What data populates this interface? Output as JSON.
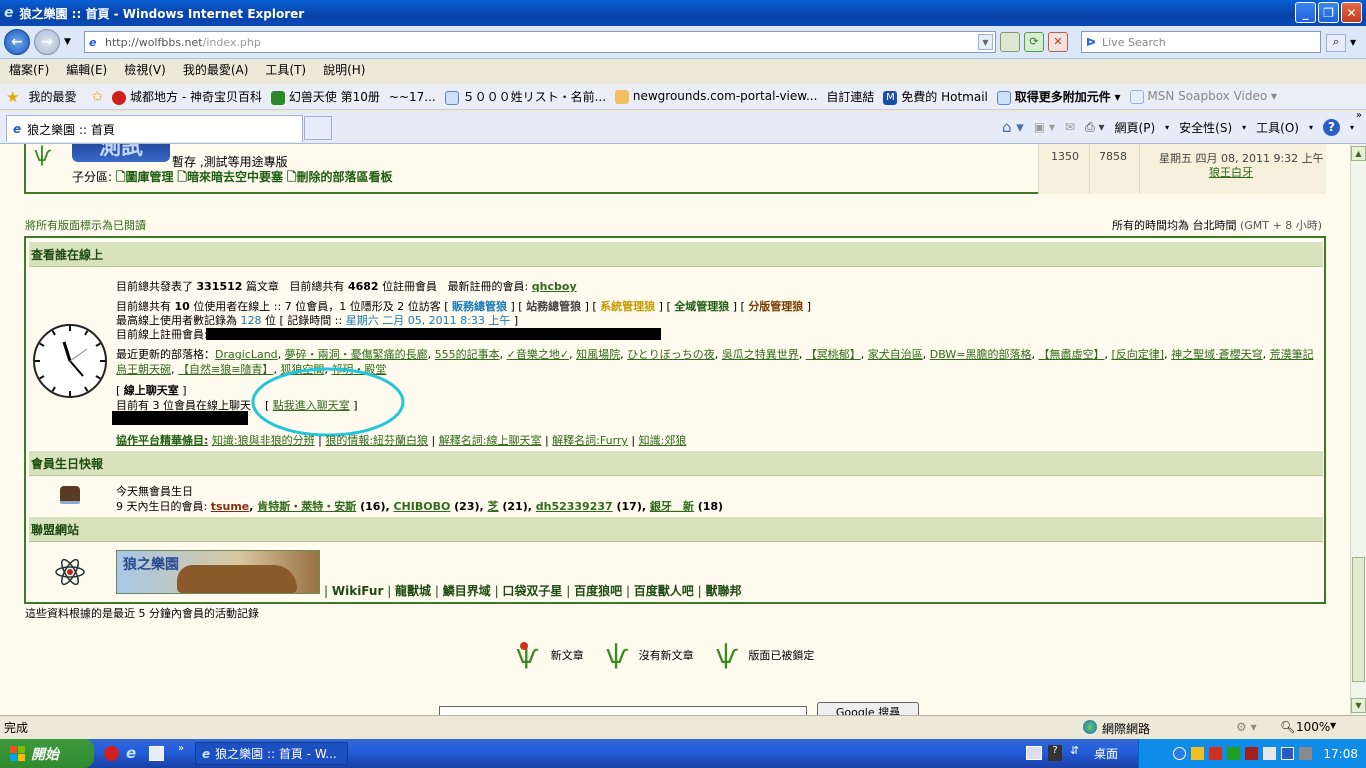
{
  "window": {
    "title": "狼之樂園 :: 首頁 - Windows Internet Explorer"
  },
  "address": {
    "url_host": "http://wolfbbs.net",
    "url_path": "/index.php"
  },
  "search": {
    "placeholder": "Live Search"
  },
  "menu": [
    "檔案(F)",
    "編輯(E)",
    "檢視(V)",
    "我的最愛(A)",
    "工具(T)",
    "說明(H)"
  ],
  "favorites": {
    "label": "我的最愛",
    "items": [
      "城都地方 - 神奇宝贝百科",
      "幻兽天使 第10册",
      "~~17...",
      "５０００姓リスト・名前...",
      "newgrounds.com-portal-view...",
      "自訂連結",
      "免費的 Hotmail",
      "取得更多附加元件",
      "MSN Soapbox Video"
    ]
  },
  "tab": {
    "label": "狼之樂園 :: 首頁"
  },
  "commandbar": [
    "網頁(P)",
    "安全性(S)",
    "工具(O)"
  ],
  "forum_top": {
    "desc": "暫存 ,測試等用途專版",
    "sub_label": "子分區:",
    "subs": [
      "圖庫管理",
      "暗來暗去空中要塞",
      "刪除的部落區看板"
    ],
    "topics": "1350",
    "posts": "7858",
    "last_time": "星期五 四月 08, 2011 9:32 上午",
    "last_user": "狼王白牙",
    "logo_text": "測試"
  },
  "mark_read": "將所有版面標示為已閱讀",
  "timezone": {
    "prefix": "所有的時間均為 台北時間",
    "suffix": "(GMT + 8 小時)"
  },
  "online": {
    "header": "查看誰在線上",
    "stats_a": "目前總共發表了",
    "stats_posts": "331512",
    "stats_b": "篇文章",
    "stats_c": "目前總共有",
    "stats_members": "4682",
    "stats_d": "位註冊會員",
    "stats_e": "最新註冊的會員:",
    "newest": "qhcboy",
    "line2_a": "目前總共有",
    "line2_num": "10",
    "line2_b": "位使用者在線上 :: 7 位會員，1 位隱形及 2 位訪客 [",
    "groups": [
      "販務總管狼",
      "站務總管狼",
      "系統管理狼",
      "全域管理狼",
      "分版管理狼"
    ],
    "line3_a": "最高線上使用者數記錄為",
    "line3_num": "128",
    "line3_b": "位 [ 記錄時間 :: ",
    "line3_time": "星期六 二月 05, 2011 8:33 上午",
    "line3_c": " ]",
    "line4": "目前線上註冊會員:",
    "blogs_label": "最近更新的部落格：",
    "blogs_1": [
      "DragicLand",
      "夢碎・兩洞・憂傷緊痛的長廊",
      "555的記事本",
      "✓音樂之地✓",
      "知風場院",
      "ひとりぼっちの夜",
      "吳瓜之特異世界",
      "【冥桃郁】",
      "家犬自治區",
      "DBW=黑膽的部落格",
      "【無盡虛空】",
      "[反向定律]",
      "神之聖域‧蒼櫻天穹",
      "荒漠筆記"
    ],
    "blogs_2": [
      "烏王朝天碗",
      "【自然≡狼≡隨青】",
      "狐狼空間",
      "祁玥・殿堂"
    ],
    "chat_title": "線上聊天室",
    "chat_count": "目前有 3 位會員在線上聊天",
    "chat_link": "點我進入聊天室",
    "partner_label": "協作平台精華條目:",
    "partners": [
      "知識:狼與非狼的分辨",
      "狼的情報:紐芬蘭白狼",
      "解釋名詞:線上聊天室",
      "解釋名詞:Furry",
      "知識:郊狼"
    ]
  },
  "birthday": {
    "header": "會員生日快報",
    "today": "今天無會員生日",
    "upcoming_label": "9 天內生日的會員:",
    "members": [
      {
        "name": "tsume",
        "age": ""
      },
      {
        "name": "肯特斯・萊特・安斯",
        "age": "(16)"
      },
      {
        "name": "CHIBOBO",
        "age": "(23)"
      },
      {
        "name": "芝",
        "age": "(21)"
      },
      {
        "name": "dh52339237",
        "age": "(17)"
      },
      {
        "name": "銀牙＿新",
        "age": "(18)"
      }
    ]
  },
  "league": {
    "header": "聯盟網站",
    "banner_text": "狼之樂園",
    "sites": [
      "WikiFur",
      "龍獸城",
      "鱗目界域",
      "口袋双子星",
      "百度狼吧",
      "百度獸人吧",
      "獸聯邦"
    ]
  },
  "activity_note": "這些資料根據的是最近 5 分鐘內會員的活動記錄",
  "legend": [
    "新文章",
    "沒有新文章",
    "版面已被鎖定"
  ],
  "google_btn": "Google 搜尋",
  "status": {
    "left": "完成",
    "zone": "網際網路",
    "zoom": "100%"
  },
  "taskbar": {
    "start": "開始",
    "item": "狼之樂園 :: 首頁 - W...",
    "desktop": "桌面",
    "clock": "17:08"
  },
  "colors": {
    "accent": "#2F6B1B",
    "header_bg": "#D8E3BD",
    "border": "#3E7A2A",
    "highlight_circle": "#22C6D8"
  }
}
